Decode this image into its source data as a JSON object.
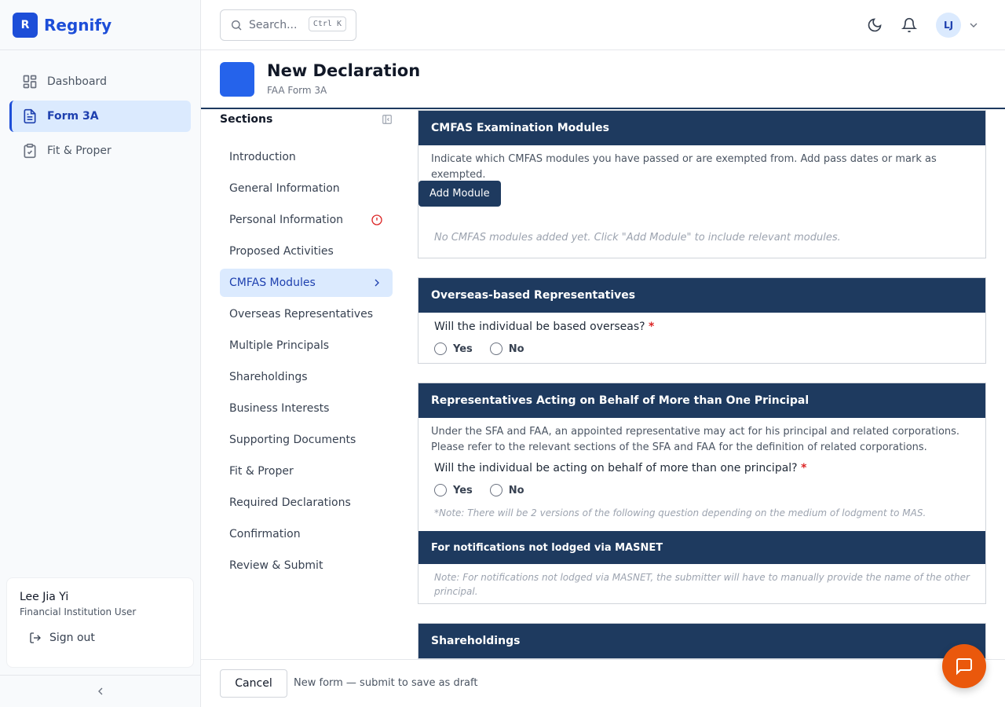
{
  "brand": {
    "logo_letter": "R",
    "name": "Regnify"
  },
  "nav": [
    {
      "label": "Dashboard",
      "icon": "dashboard-icon"
    },
    {
      "label": "Form 3A",
      "icon": "document-icon",
      "active": true
    },
    {
      "label": "Fit & Proper",
      "icon": "clipboard-check-icon"
    }
  ],
  "user": {
    "name": "Lee Jia Yi",
    "role": "Financial Institution User",
    "signout_label": "Sign out",
    "initials": "LJ"
  },
  "search": {
    "placeholder": "Search...",
    "shortcut": "Ctrl K"
  },
  "page": {
    "title": "New Declaration",
    "subtitle": "FAA Form 3A"
  },
  "sections": {
    "title": "Sections",
    "items": [
      {
        "label": "Introduction"
      },
      {
        "label": "General Information"
      },
      {
        "label": "Personal Information",
        "status": "error"
      },
      {
        "label": "Proposed Activities"
      },
      {
        "label": "CMFAS Modules",
        "active": true
      },
      {
        "label": "Overseas Representatives"
      },
      {
        "label": "Multiple Principals"
      },
      {
        "label": "Shareholdings"
      },
      {
        "label": "Business Interests"
      },
      {
        "label": "Supporting Documents"
      },
      {
        "label": "Fit & Proper"
      },
      {
        "label": "Required Declarations"
      },
      {
        "label": "Confirmation"
      },
      {
        "label": "Review & Submit"
      }
    ]
  },
  "cmfas": {
    "title": "CMFAS Examination Modules",
    "description": "Indicate which CMFAS modules you have passed or are exempted from. Add pass dates or mark as exempted.",
    "add_button": "Add Module",
    "empty": "No CMFAS modules added yet. Click \"Add Module\" to include relevant modules."
  },
  "overseas": {
    "title": "Overseas-based Representatives",
    "question": "Will the individual be based overseas?",
    "required_mark": "*",
    "options": [
      "Yes",
      "No"
    ]
  },
  "multi": {
    "title": "Representatives Acting on Behalf of More than One Principal",
    "description": "Under the SFA and FAA, an appointed representative may act for his principal and related corporations. Please refer to the relevant sections of the SFA and FAA for the definition of related corporations.",
    "question": "Will the individual be acting on behalf of more than one principal?",
    "required_mark": "*",
    "options": [
      "Yes",
      "No"
    ],
    "note": "*Note: There will be 2 versions of the following question depending on the medium of lodgment to MAS.",
    "sub_title": "For notifications not lodged via MASNET",
    "sub_note": "Note: For notifications not lodged via MASNET, the submitter will have to manually provide the name of the other principal."
  },
  "shareholdings": {
    "title": "Shareholdings"
  },
  "footer": {
    "cancel_label": "Cancel",
    "message": "New form — submit to save as draft"
  },
  "colors": {
    "primary": "#1d4ed8",
    "header_navy": "#1e3a5f",
    "chat_orange": "#ea580c",
    "error": "#dc2626"
  }
}
